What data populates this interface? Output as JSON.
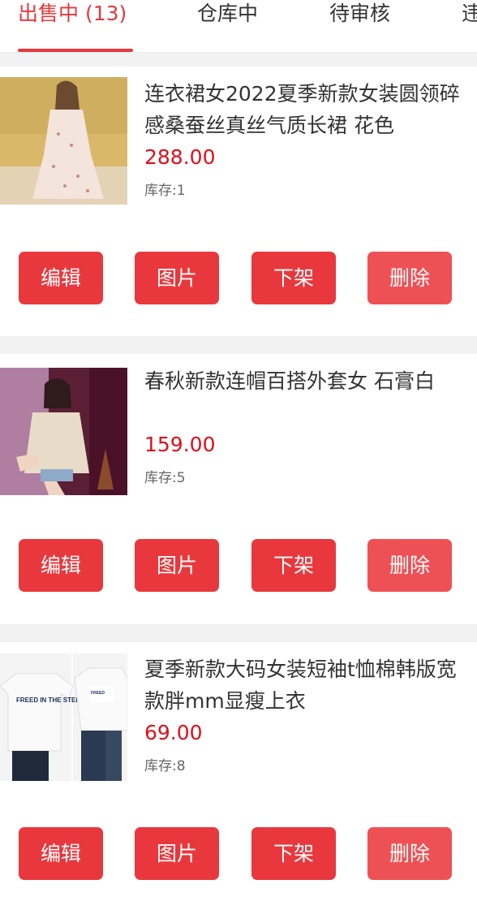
{
  "tabs": [
    {
      "label": "出售中 (13)",
      "active": true
    },
    {
      "label": "仓库中",
      "active": false
    },
    {
      "label": "待审核",
      "active": false
    },
    {
      "label": "违",
      "active": false
    }
  ],
  "buttons": {
    "edit": "编辑",
    "images": "图片",
    "unlist": "下架",
    "delete": "删除"
  },
  "products": [
    {
      "title_line1": "连衣裙女2022夏季新款女装圆领碎",
      "title_line2": "感桑蚕丝真丝气质长裙 花色",
      "price": "288.00",
      "stock": "库存:1"
    },
    {
      "title_line1": "春秋新款连帽百搭外套女 石膏白",
      "title_line2": "",
      "price": "159.00",
      "stock": "库存:5"
    },
    {
      "title_line1": "夏季新款大码女装短袖t恤棉韩版宽",
      "title_line2": "款胖mm显瘦上衣",
      "price": "69.00",
      "stock": "库存:8",
      "image_print": "FREED IN THE STERRT"
    }
  ],
  "colors": {
    "accent": "#e8383d",
    "price": "#e20e1b"
  }
}
